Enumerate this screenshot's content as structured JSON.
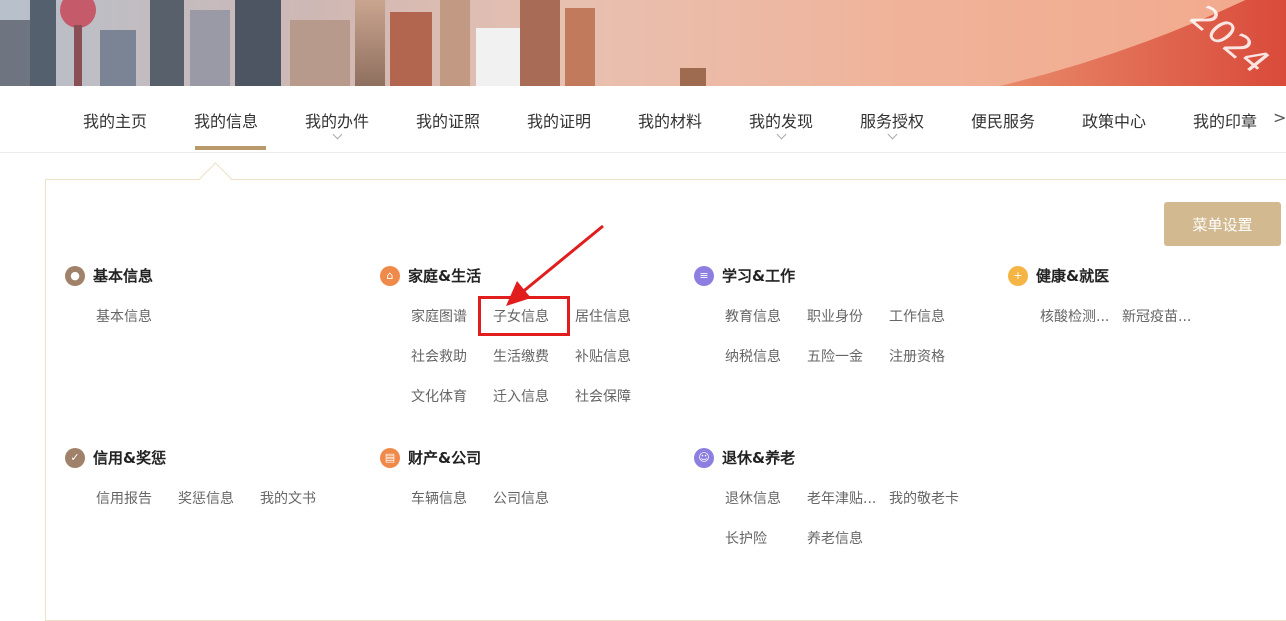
{
  "banner": {
    "year_text": "2024"
  },
  "nav": {
    "items": [
      {
        "label": "我的主页",
        "has_dropdown": false
      },
      {
        "label": "我的信息",
        "has_dropdown": false,
        "active": true
      },
      {
        "label": "我的办件",
        "has_dropdown": true
      },
      {
        "label": "我的证照",
        "has_dropdown": false
      },
      {
        "label": "我的证明",
        "has_dropdown": false
      },
      {
        "label": "我的材料",
        "has_dropdown": false
      },
      {
        "label": "我的发现",
        "has_dropdown": true
      },
      {
        "label": "服务授权",
        "has_dropdown": true
      },
      {
        "label": "便民服务",
        "has_dropdown": false
      },
      {
        "label": "政策中心",
        "has_dropdown": false
      },
      {
        "label": "我的印章",
        "has_dropdown": false
      }
    ],
    "more_icon": ">"
  },
  "panel": {
    "menu_settings_label": "菜单设置",
    "categories": [
      {
        "title": "基本信息",
        "icon": "person-icon",
        "icon_color": "#a0826a",
        "links": [
          "基本信息"
        ]
      },
      {
        "title": "家庭&生活",
        "icon": "home-icon",
        "icon_color": "#f08a4b",
        "links": [
          "家庭图谱",
          "子女信息",
          "居住信息",
          "社会救助",
          "生活缴费",
          "补贴信息",
          "文化体育",
          "迁入信息",
          "社会保障"
        ]
      },
      {
        "title": "学习&工作",
        "icon": "book-icon",
        "icon_color": "#8c7fe0",
        "links": [
          "教育信息",
          "职业身份",
          "工作信息",
          "纳税信息",
          "五险一金",
          "注册资格"
        ]
      },
      {
        "title": "健康&就医",
        "icon": "medical-icon",
        "icon_color": "#f4b544",
        "links": [
          "核酸检测...",
          "新冠疫苗..."
        ]
      },
      {
        "title": "信用&奖惩",
        "icon": "check-icon",
        "icon_color": "#a0826a",
        "links": [
          "信用报告",
          "奖惩信息",
          "我的文书"
        ]
      },
      {
        "title": "财产&公司",
        "icon": "building-icon",
        "icon_color": "#f08a4b",
        "links": [
          "车辆信息",
          "公司信息"
        ]
      },
      {
        "title": "退休&养老",
        "icon": "elder-icon",
        "icon_color": "#8c7fe0",
        "links": [
          "退休信息",
          "老年津贴...",
          "我的敬老卡",
          "长护险",
          "养老信息"
        ]
      }
    ],
    "highlighted_link": "子女信息"
  }
}
